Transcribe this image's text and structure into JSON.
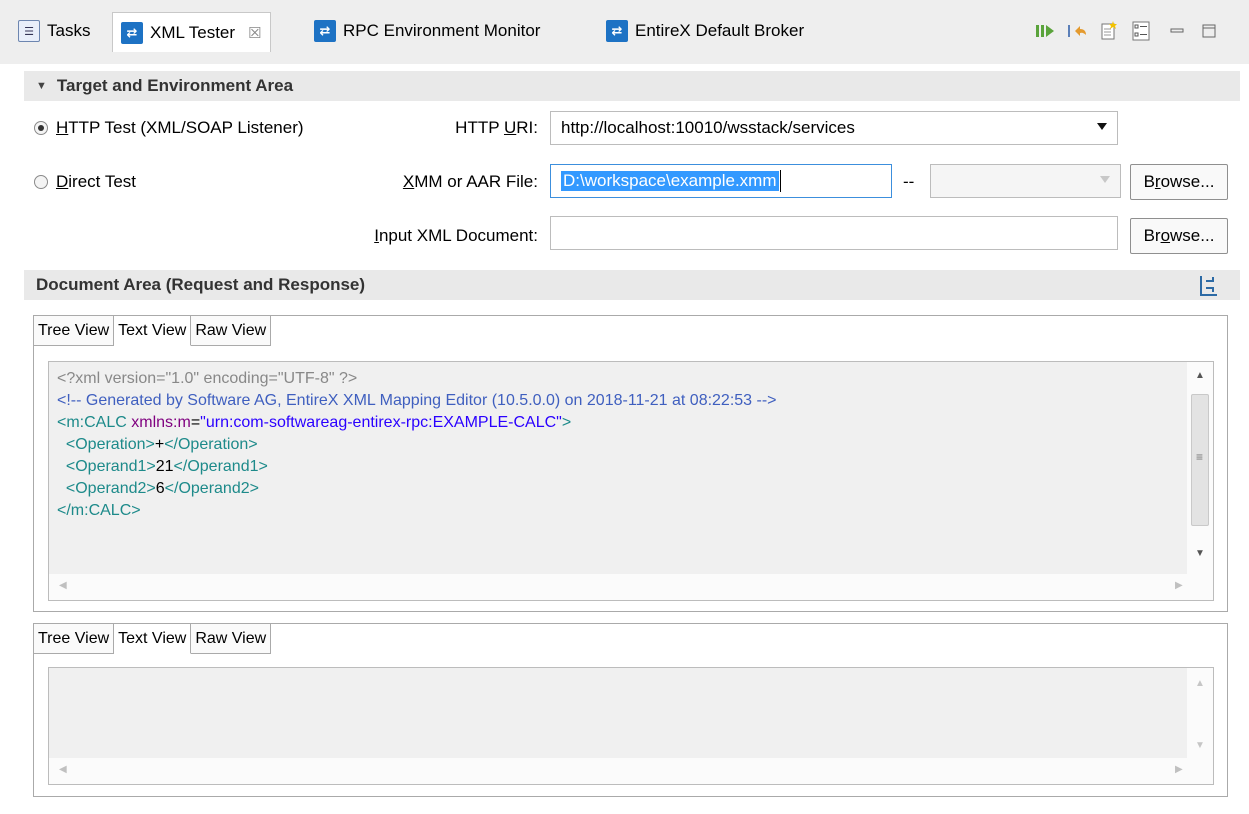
{
  "tabs": [
    {
      "label": "Tasks",
      "icon": "tasks-icon"
    },
    {
      "label": "XML Tester",
      "icon": "xml-tester-icon",
      "close": "☒",
      "active": true
    },
    {
      "label": "RPC Environment Monitor",
      "icon": "rpc-monitor-icon"
    },
    {
      "label": "EntireX Default Broker",
      "icon": "broker-icon"
    }
  ],
  "target_section": {
    "title": "Target and Environment Area",
    "http_test": {
      "pre": "H",
      "under": "",
      "rest": "TTP Test (XML/SOAP Listener)",
      "selected": true
    },
    "direct_test": {
      "under": "D",
      "rest": "irect Test",
      "selected": false
    },
    "http_uri": {
      "label_pre": "HTTP ",
      "label_under": "U",
      "label_post": "RI:",
      "value": "http://localhost:10010/wsstack/services"
    },
    "xmm_file": {
      "label_under": "X",
      "label_post": "MM or AAR File:",
      "value": "D:\\workspace\\example.xmm",
      "separator": "--",
      "browse_pre": "B",
      "browse_under": "r",
      "browse_post": "owse..."
    },
    "input_xml": {
      "label_under": "I",
      "label_post": "nput XML Document:",
      "value": "",
      "browse_pre": "Br",
      "browse_under": "o",
      "browse_post": "wse..."
    }
  },
  "document_section": {
    "title": "Document Area (Request and Response)"
  },
  "request_pane": {
    "tabs": [
      "Tree View",
      "Text View",
      "Raw View"
    ],
    "active_tab": "Text View",
    "lines": {
      "decl": "<?xml version=\"1.0\" encoding=\"UTF-8\" ?>",
      "comment": "<!-- Generated by Software AG, EntireX XML Mapping Editor (10.5.0.0) on 2018-11-21 at 08:22:53 -->",
      "root_open": "<m:CALC",
      "root_attr": "xmlns:m",
      "root_eq": "=",
      "root_val": "\"urn:com-softwareag-entirex-rpc:EXAMPLE-CALC\"",
      "root_close": ">",
      "op_open": "<Operation>",
      "op_val": "+",
      "op_close": "</Operation>",
      "o1_open": "<Operand1>",
      "o1_val": "21",
      "o1_close": "</Operand1>",
      "o2_open": "<Operand2>",
      "o2_val": "6",
      "o2_close": "</Operand2>",
      "root_end": "</m:CALC>"
    }
  },
  "response_pane": {
    "tabs": [
      "Tree View",
      "Text View",
      "Raw View"
    ],
    "active_tab": "Text View"
  }
}
